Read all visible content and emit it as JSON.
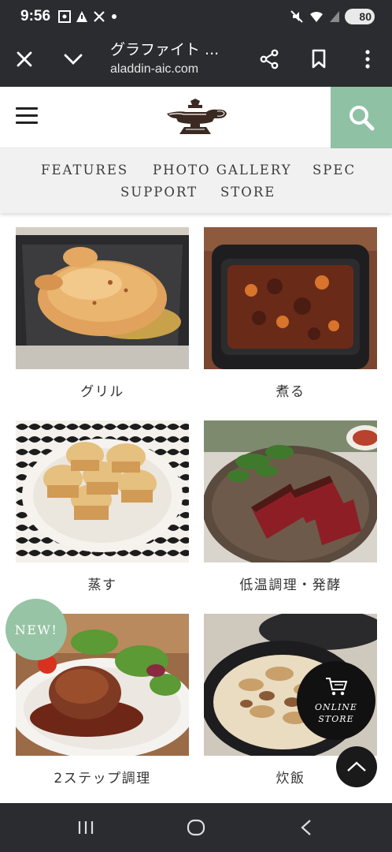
{
  "status_bar": {
    "time": "9:56",
    "battery": "80",
    "icons": [
      "screenshot-icon",
      "triangle-alert-icon",
      "x-app-icon",
      "dot-icon",
      "mute-icon",
      "wifi-icon",
      "signal-icon",
      "battery-icon"
    ]
  },
  "browser": {
    "title": "グラファイト ...",
    "url": "aladdin-aic.com"
  },
  "site": {
    "nav": [
      "FEATURES",
      "PHOTO GALLERY",
      "SPEC",
      "SUPPORT",
      "STORE"
    ],
    "tiles": [
      {
        "caption": "グリル"
      },
      {
        "caption": "煮る"
      },
      {
        "caption": "蒸す"
      },
      {
        "caption": "低温調理・発酵"
      },
      {
        "caption": "2ステップ調理"
      },
      {
        "caption": "炊飯"
      }
    ],
    "new_badge": "NEW!",
    "online_store_line1": "ONLINE",
    "online_store_line2": "STORE"
  },
  "colors": {
    "accent_green": "#8fc1a5",
    "dark_bar": "#2a2c2f"
  }
}
